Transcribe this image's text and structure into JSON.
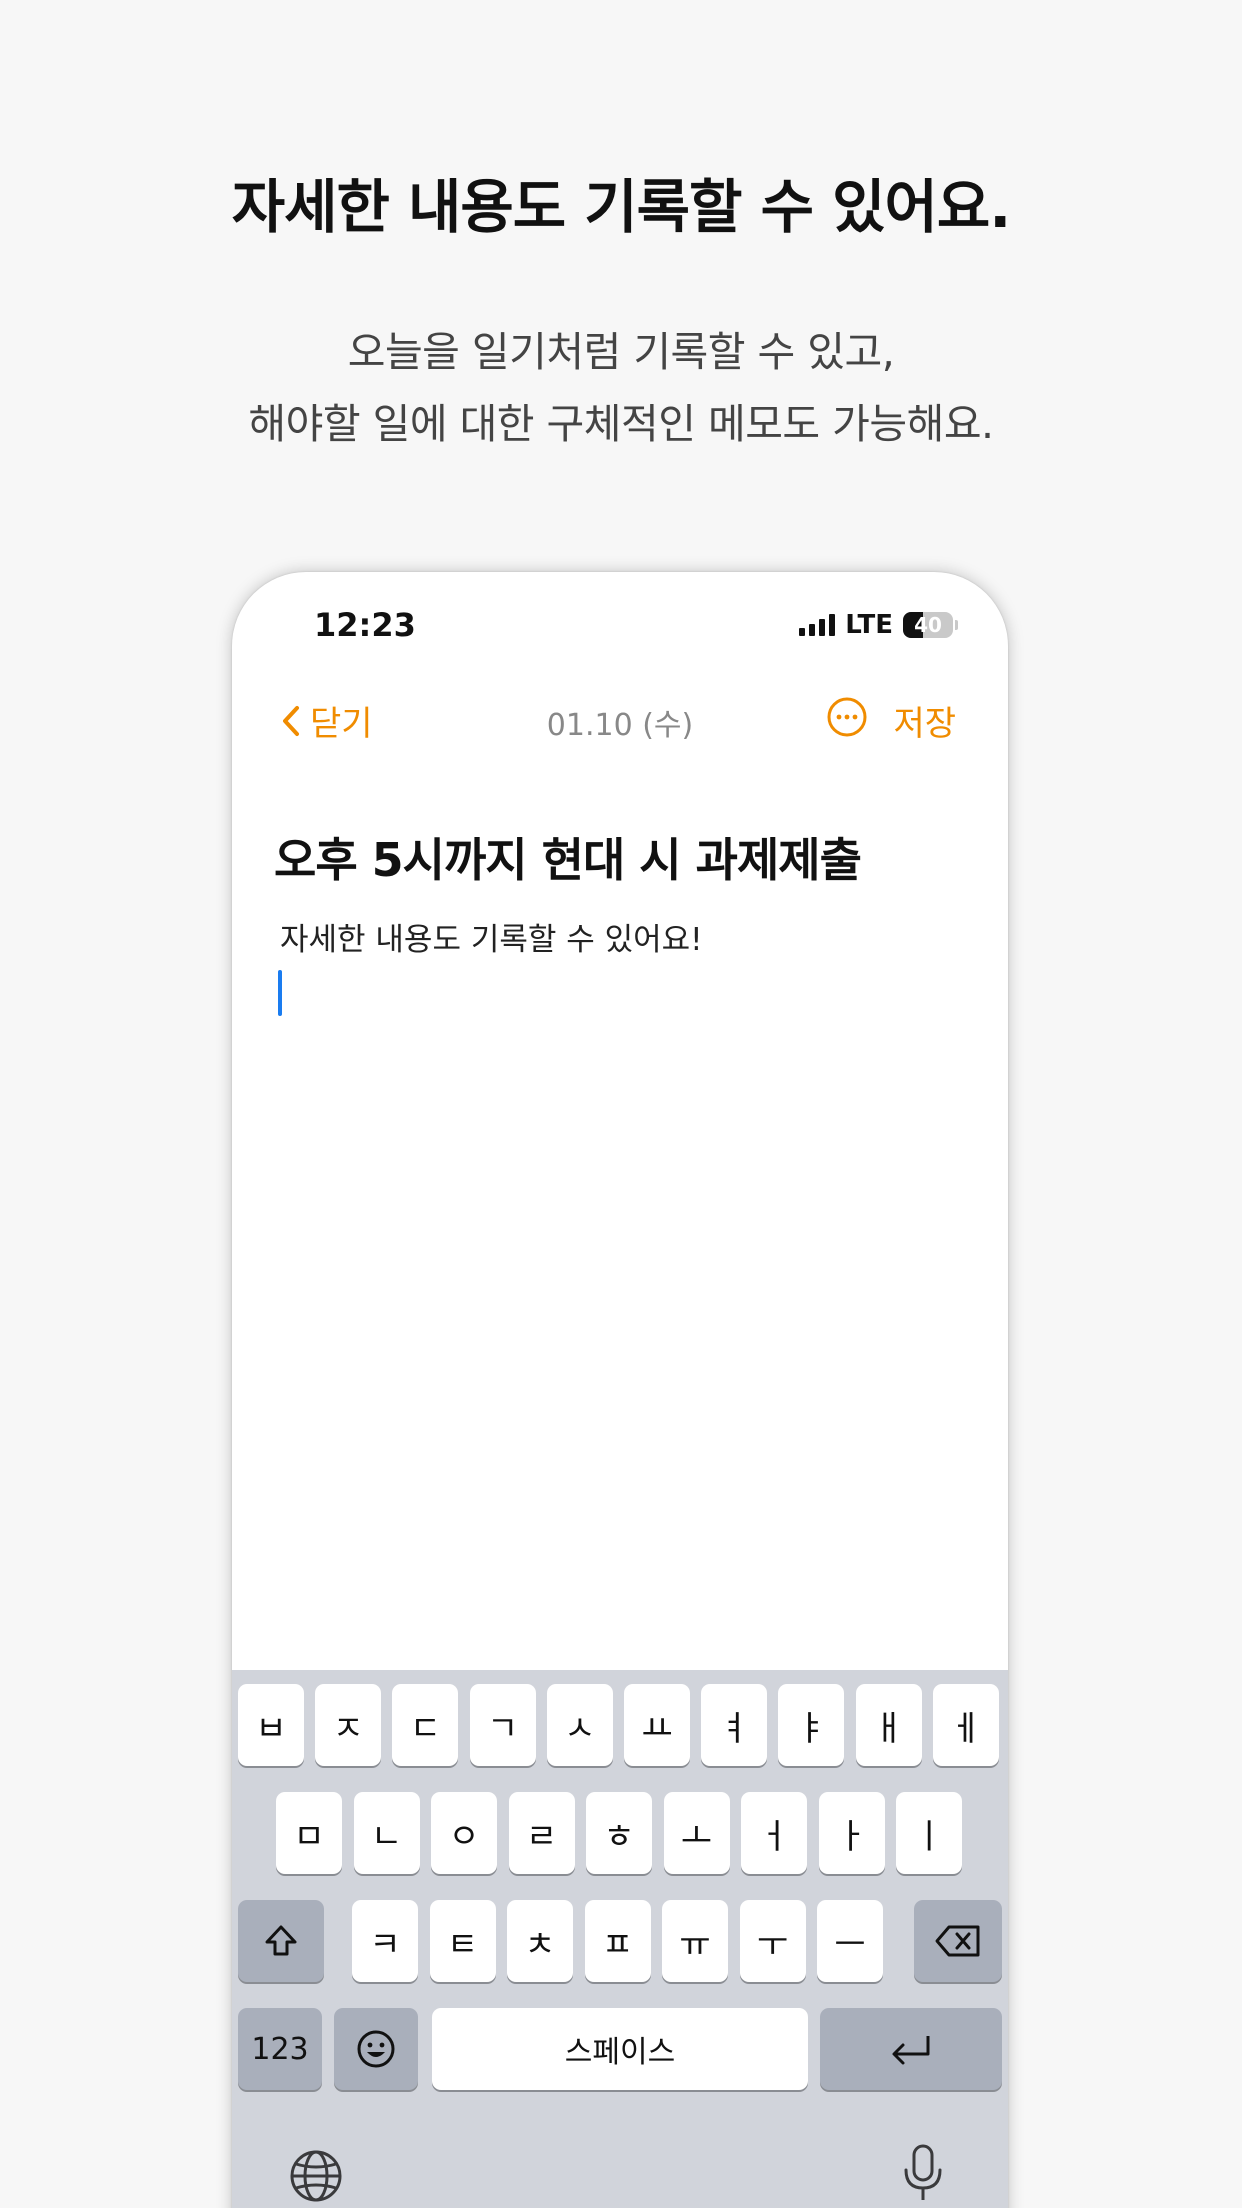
{
  "promo": {
    "headline": "자세한 내용도 기록할 수 있어요.",
    "subtext_line1": "오늘을 일기처럼 기록할 수 있고,",
    "subtext_line2": "해야할 일에 대한 구체적인 메모도 가능해요."
  },
  "status_bar": {
    "time": "12:23",
    "network": "LTE",
    "battery": "40"
  },
  "nav": {
    "back_label": "닫기",
    "date": "01.10 (수)",
    "save_label": "저장"
  },
  "memo": {
    "title": "오후 5시까지 현대 시 과제제출",
    "body": "자세한 내용도 기록할 수 있어요!"
  },
  "keyboard": {
    "row1": [
      "ㅂ",
      "ㅈ",
      "ㄷ",
      "ㄱ",
      "ㅅ",
      "ㅛ",
      "ㅕ",
      "ㅑ",
      "ㅐ",
      "ㅔ"
    ],
    "row2": [
      "ㅁ",
      "ㄴ",
      "ㅇ",
      "ㄹ",
      "ㅎ",
      "ㅗ",
      "ㅓ",
      "ㅏ",
      "ㅣ"
    ],
    "row3": [
      "ㅋ",
      "ㅌ",
      "ㅊ",
      "ㅍ",
      "ㅠ",
      "ㅜ",
      "ㅡ"
    ],
    "numbers_label": "123",
    "space_label": "스페이스"
  },
  "colors": {
    "accent": "#f08c00",
    "cursor": "#1a7cf0",
    "keyboard_bg": "#d1d4db"
  },
  "icons": [
    "chevron-left-icon",
    "more-icon",
    "shift-icon",
    "backspace-icon",
    "emoji-icon",
    "return-icon",
    "globe-icon",
    "mic-icon"
  ]
}
